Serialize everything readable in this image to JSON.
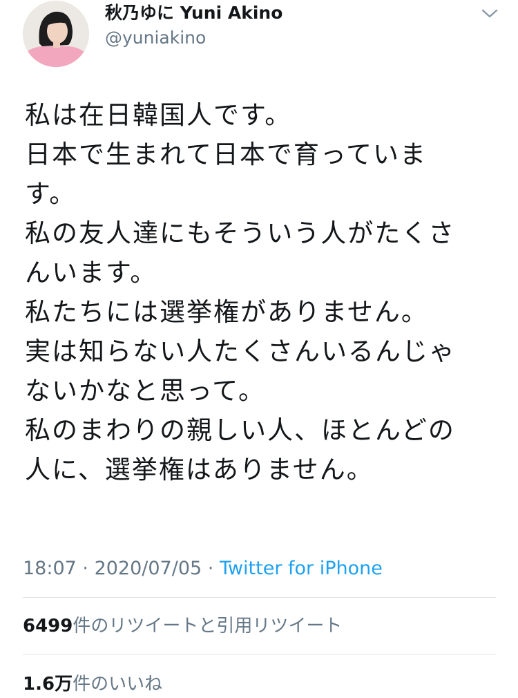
{
  "author": {
    "display_name": "秋乃ゆに Yuni Akino",
    "username": "@yuniakino"
  },
  "tweet": {
    "lines": [
      "私は在日韓国人です。",
      "日本で生まれて日本で育っていま",
      "す。",
      "私の友人達にもそういう人がたくさ",
      "んいます。",
      "私たちには選挙権がありません。",
      "実は知らない人たくさんいるんじゃ",
      "ないかなと思って。",
      "私のまわりの親しい人、ほとんどの",
      "人に、選挙権はありません。"
    ]
  },
  "meta": {
    "time": "18:07",
    "separator": " · ",
    "date": "2020/07/05",
    "source": "Twitter for iPhone"
  },
  "stats": {
    "retweets_count": "6499",
    "retweets_label": "件のリツイートと引用リツイート",
    "likes_count": "1.6万",
    "likes_label": "件のいいね"
  },
  "icons": {
    "menu": "chevron-down-icon",
    "avatar": "profile-photo"
  },
  "colors": {
    "text": "#14171a",
    "secondary": "#657786",
    "link": "#1da1f2",
    "divider": "#dfe3e6"
  }
}
